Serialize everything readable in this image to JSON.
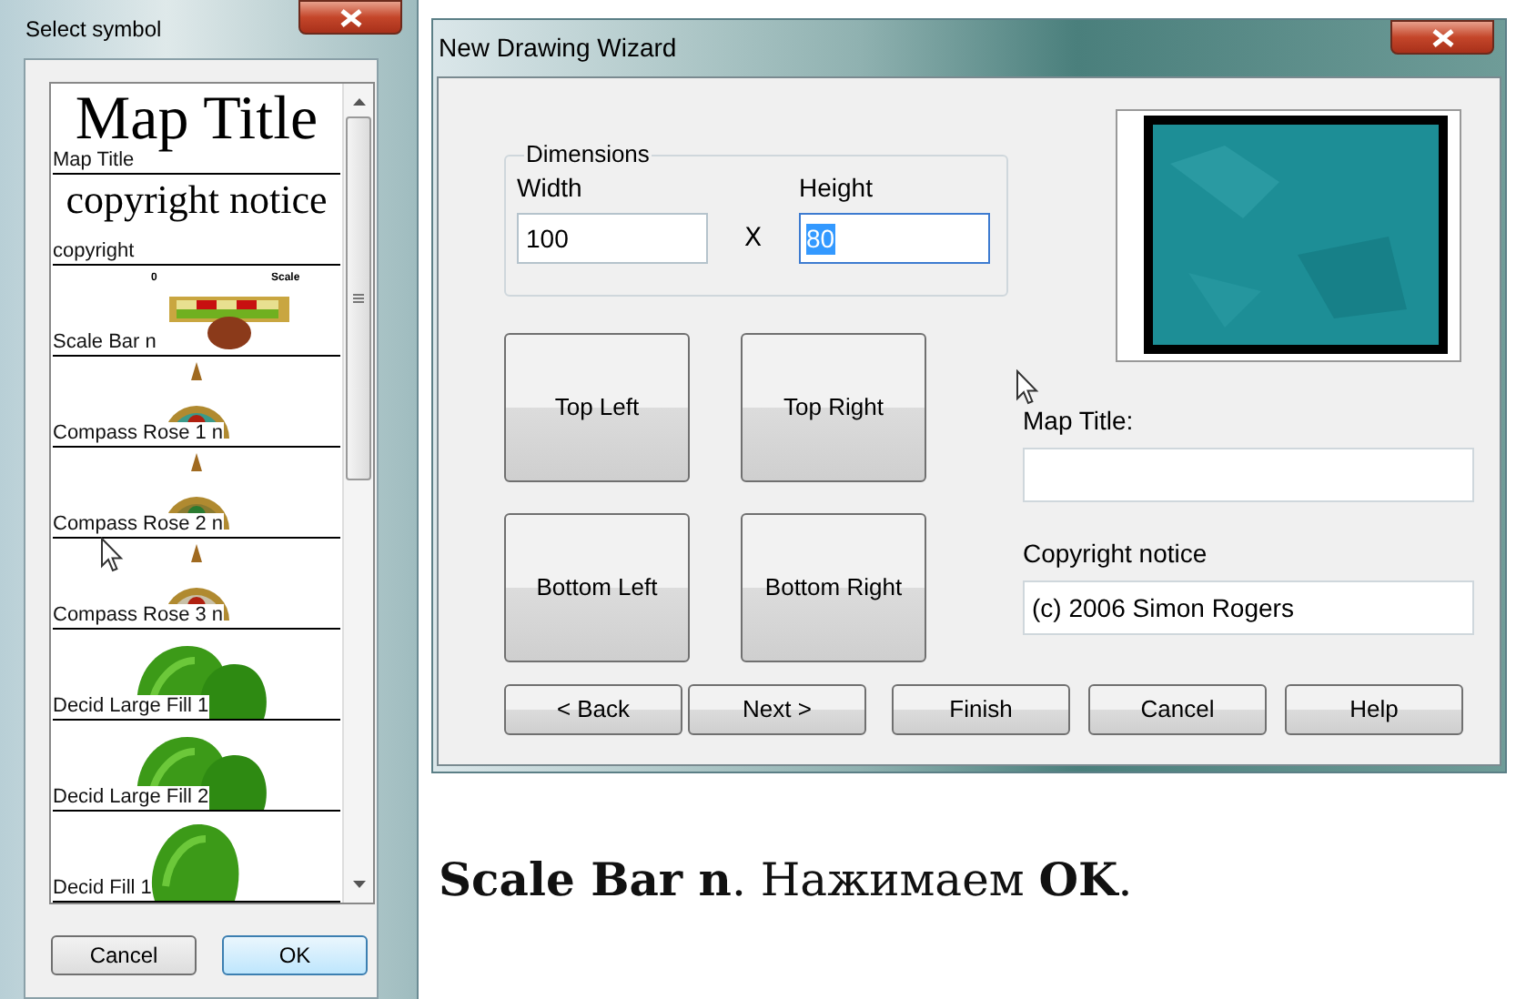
{
  "symbol_dialog": {
    "title": "Select symbol",
    "items": [
      {
        "kind": "text",
        "label": "Map Title",
        "preview_text": "Map Title"
      },
      {
        "kind": "text",
        "label": "copyright",
        "preview_text": "copyright notice"
      },
      {
        "kind": "scale",
        "label": "Scale Bar n",
        "preview_texts": [
          "0",
          "Scale"
        ]
      },
      {
        "kind": "compass",
        "label": "Compass Rose 1 n"
      },
      {
        "kind": "compass",
        "label": "Compass Rose 2 n"
      },
      {
        "kind": "compass",
        "label": "Compass Rose 3 n"
      },
      {
        "kind": "trees",
        "label": "Decid Large Fill 1"
      },
      {
        "kind": "trees",
        "label": "Decid Large Fill 2"
      },
      {
        "kind": "tree",
        "label": "Decid Fill 1"
      }
    ],
    "buttons": [
      {
        "label": "Cancel",
        "default": false
      },
      {
        "label": "OK",
        "default": true
      }
    ]
  },
  "wizard": {
    "title": "New Drawing Wizard",
    "dimensions": {
      "label": "Dimensions",
      "width_label": "Width",
      "width_value": "100",
      "times": "X",
      "height_label": "Height",
      "height_value": "80",
      "height_selected": true
    },
    "corner_buttons": [
      "Top Left",
      "Top Right",
      "Bottom Left",
      "Bottom Right"
    ],
    "map_title_label": "Map Title:",
    "copyright_label": "Copyright notice",
    "copyright_value": "(c) 2006 Simon Rogers",
    "nav_buttons": [
      "< Back",
      "Next >",
      "Finish",
      "Cancel",
      "Help"
    ]
  },
  "caption": "**Scale Bar n**. Нажимаем **OK**."
}
